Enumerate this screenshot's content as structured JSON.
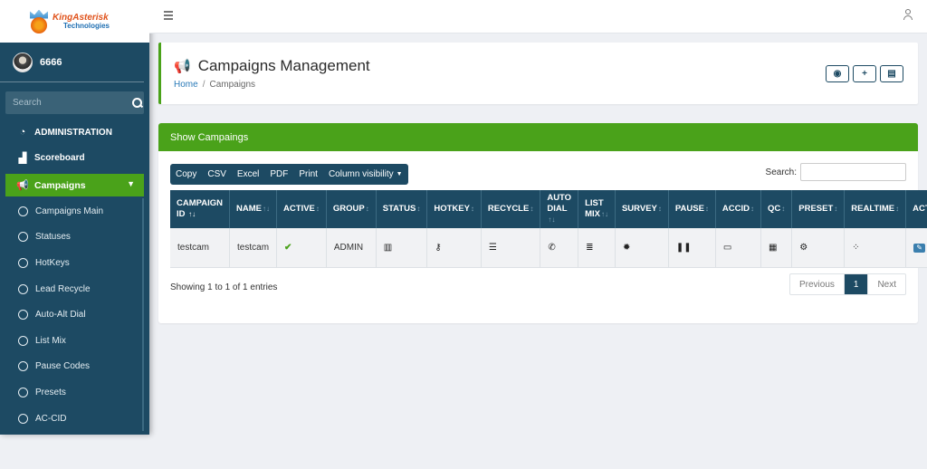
{
  "brand": {
    "line1": "KingAsterisk",
    "line2": "Technologies"
  },
  "user": {
    "name": "6666"
  },
  "sidebar": {
    "search_placeholder": "Search",
    "administration": "ADMINISTRATION",
    "scoreboard": "Scoreboard",
    "campaigns": "Campaigns",
    "sub_items": [
      "Campaigns Main",
      "Statuses",
      "HotKeys",
      "Lead Recycle",
      "Auto-Alt Dial",
      "List Mix",
      "Pause Codes",
      "Presets",
      "AC-CID"
    ]
  },
  "header": {
    "title": "Campaigns Management",
    "breadcrumb_home": "Home",
    "breadcrumb_sep": "/",
    "breadcrumb_current": "Campaigns"
  },
  "card": {
    "title": "Show Campaings",
    "export_buttons": [
      "Copy",
      "CSV",
      "Excel",
      "PDF",
      "Print",
      "Column visibility"
    ],
    "search_label": "Search:"
  },
  "table": {
    "headers": [
      {
        "line1": "CAMPAIGN",
        "line2": "ID"
      },
      {
        "line1": "NAME",
        "line2": ""
      },
      {
        "line1": "ACTIVE",
        "line2": ""
      },
      {
        "line1": "GROUP",
        "line2": ""
      },
      {
        "line1": "STATUS",
        "line2": ""
      },
      {
        "line1": "HOTKEY",
        "line2": ""
      },
      {
        "line1": "RECYCLE",
        "line2": ""
      },
      {
        "line1": "AUTO",
        "line2": "DIAL"
      },
      {
        "line1": "LIST",
        "line2": "MIX"
      },
      {
        "line1": "SURVEY",
        "line2": ""
      },
      {
        "line1": "PAUSE",
        "line2": ""
      },
      {
        "line1": "ACCID",
        "line2": ""
      },
      {
        "line1": "QC",
        "line2": ""
      },
      {
        "line1": "PRESET",
        "line2": ""
      },
      {
        "line1": "REALTIME",
        "line2": ""
      },
      {
        "line1": "ACTION",
        "line2": ""
      }
    ],
    "row": {
      "campaign_id": "testcam",
      "name": "testcam",
      "group": "ADMIN"
    }
  },
  "footer": {
    "showing": "Showing 1 to 1 of 1 entries",
    "previous": "Previous",
    "page": "1",
    "next": "Next"
  },
  "colors": {
    "sidebar": "#1d4a63",
    "accent_green": "#4aa21a",
    "link": "#2a7ab8"
  }
}
